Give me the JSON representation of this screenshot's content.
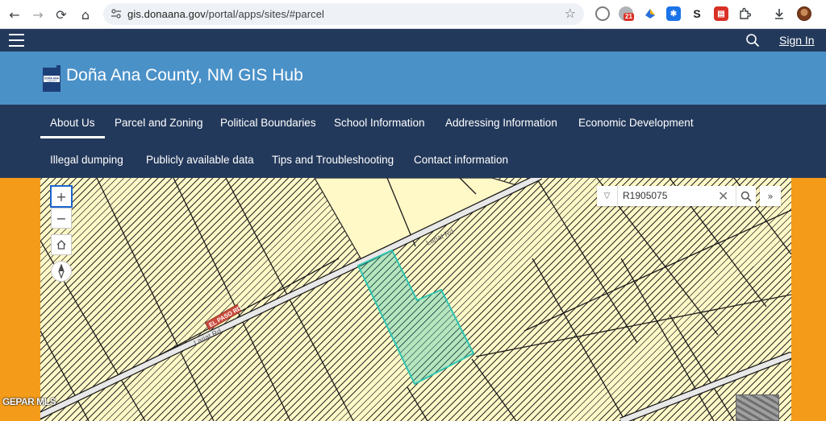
{
  "browser": {
    "url_host": "gis.donaana.gov",
    "url_path": "/portal/apps/sites/#parcel",
    "extension_badge": "21",
    "extensions": [
      {
        "icon": "camera-extension-icon",
        "color": "#7b7b7b"
      },
      {
        "icon": "google-lens-extension-icon",
        "color": "#9aa0a6"
      },
      {
        "icon": "bird-extension-icon",
        "color": "#2b6ed9"
      },
      {
        "icon": "gear-extension-icon",
        "color": "#1a73e8"
      },
      {
        "icon": "s-extension-icon",
        "color": "#202124"
      },
      {
        "icon": "red-extension-icon",
        "color": "#d93025"
      },
      {
        "icon": "puzzle-icon",
        "color": "#5f6368"
      }
    ]
  },
  "site": {
    "sign_in": "Sign In",
    "title": "Doña Ana County, NM GIS Hub",
    "logo_text": "DOÑA ANA COUNTY"
  },
  "nav": {
    "row1": [
      "About Us",
      "Parcel and Zoning",
      "Political Boundaries",
      "School Information",
      "Addressing Information",
      "Economic Development"
    ],
    "row2": [
      "Illegal dumping",
      "Publicly available data",
      "Tips and Troubleshooting",
      "Contact information"
    ],
    "active": "About Us"
  },
  "map": {
    "search_value": "R1905075",
    "road_label_1": "Lariat Rd",
    "road_label_2": "Lariat Rd",
    "road_label_3": "EL PASO RD",
    "zoom_in": "+",
    "zoom_out": "−",
    "colors": {
      "parcel_fill": "#fff8c7",
      "selected": "#2ec4b0",
      "road": "#e8e8e8",
      "zoning_fill": "#fff3a8"
    }
  },
  "watermark": "GEPAR MLS"
}
